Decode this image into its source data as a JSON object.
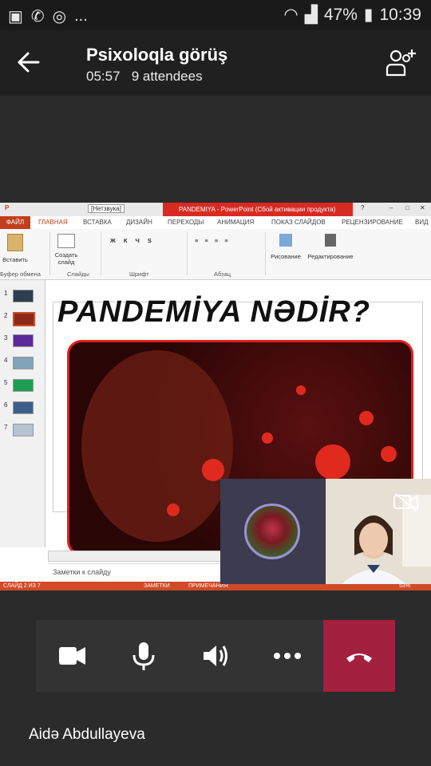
{
  "status_bar": {
    "time": "10:39",
    "battery": "47%",
    "more": "..."
  },
  "meeting": {
    "title": "Psixoloqla görüş",
    "duration": "05:57",
    "attendees": "9 attendees"
  },
  "ppt": {
    "window_title": "PANDEMIYA - PowerPoint (Сбой активации продукта)",
    "language_box": "[Нетзвука]",
    "tabs": [
      "ФАЙЛ",
      "ГЛАВНАЯ",
      "ВСТАВКА",
      "ДИЗАЙН",
      "ПЕРЕХОДЫ",
      "АНИМАЦИЯ",
      "ПОКАЗ СЛАЙДОВ",
      "РЕЦЕНЗИРОВАНИЕ",
      "ВИД"
    ],
    "ribbon": {
      "paste": "Вставить",
      "new_slide": "Создать слайд",
      "drawing": "Рисование",
      "editing": "Редактирование",
      "groups": [
        "Буфер обмена",
        "Слайды",
        "Шрифт",
        "Абзац"
      ]
    },
    "thumb_numbers": [
      "1",
      "2",
      "3",
      "4",
      "5",
      "6",
      "7"
    ],
    "slide_title": "PANDEMİYA NƏDİR?",
    "notes_placeholder": "Заметки к слайду",
    "status": {
      "slide_of": "СЛАЙД 2 ИЗ 7",
      "notes": "ЗАМЕТКИ",
      "comments": "ПРИМЕЧАНИЯ",
      "zoom": "53%"
    }
  },
  "participant": {
    "name": "Aidə Abdullayeva"
  },
  "colors": {
    "hangup": "#a3203f",
    "ppt_red": "#d04a26",
    "avatar_ring": "#9a94d6"
  }
}
